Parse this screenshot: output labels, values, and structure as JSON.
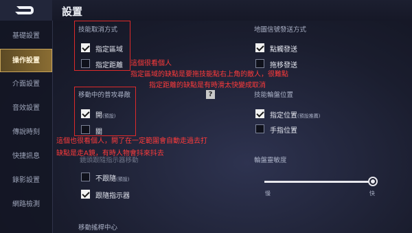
{
  "header": {
    "title": "設置"
  },
  "sidebar": {
    "items": [
      {
        "label": "基礎設置"
      },
      {
        "label": "操作設置"
      },
      {
        "label": "介面設置"
      },
      {
        "label": "音效設置"
      },
      {
        "label": "傳說時刻"
      },
      {
        "label": "快捷訊息"
      },
      {
        "label": "錄影設置"
      },
      {
        "label": "網路檢測"
      }
    ]
  },
  "cancel_skill": {
    "title": "技能取消方式",
    "opt1": "指定區域",
    "opt2": "指定距離"
  },
  "map_signal": {
    "title": "地圖信號發送方式",
    "opt1": "點觸發送",
    "opt2": "拖移發送"
  },
  "move_attack": {
    "title": "移動中的普攻尋敵",
    "opt1": "開",
    "opt1_note": "(預設)",
    "opt2": "關"
  },
  "wheel_pos": {
    "title": "技能輪盤位置",
    "opt1": "指定位置",
    "opt1_note": "(預設推薦)",
    "opt2": "手指位置"
  },
  "lens_follow": {
    "title": "鏡頭跟隨指示器移動",
    "opt1": "不跟隨",
    "opt1_note": "(預設)",
    "opt2": "跟隨指示器"
  },
  "wheel_sens": {
    "title": "輪盤靈敏度",
    "slow": "慢",
    "fast": "快",
    "value_fraction": 1.0
  },
  "move_center": {
    "title": "移動搖桿中心"
  },
  "help": {
    "symbol": "?"
  },
  "notes": {
    "n1": "這個很看個人",
    "n2": "指定區域的缺點是要拖技能點右上角的敵人，很難點",
    "n3": "指定距離的缺點是有時滑太快變成取消",
    "n4": "這個也很看個人，開了在一定範圍會自動走過去打",
    "n5": "缺點是走A鏡，有時人物會抖來抖去"
  }
}
